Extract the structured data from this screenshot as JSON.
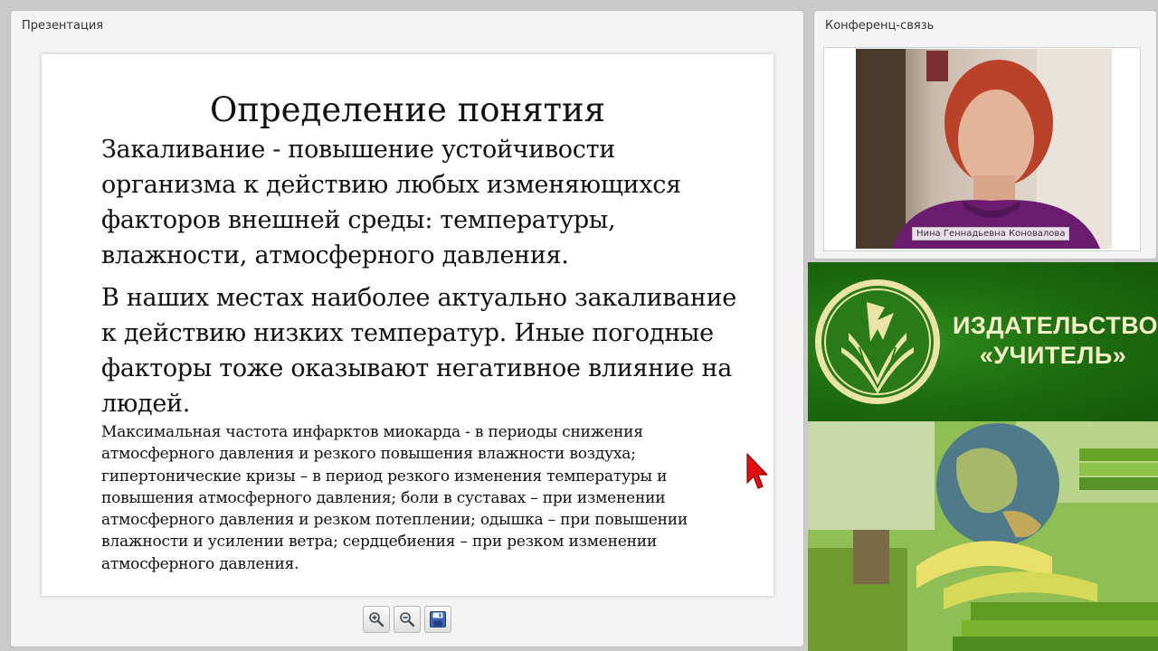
{
  "presentation": {
    "panel_title": "Презентация",
    "slide": {
      "title": "Определение понятия",
      "paragraph_1": "Закаливание - повышение устойчивости организма к действию любых изменяющихся факторов внешней среды: температуры, влажности, атмосферного давления.",
      "paragraph_2": "В наших местах наиболее актуально закаливание к действию низких температур. Иные погодные факторы тоже оказывают негативное влияние на людей.",
      "paragraph_3": "Максимальная частота инфарктов миокарда - в периоды снижения атмосферного давления и резкого повышения влажности воздуха; гипертонические кризы – в период резкого изменения температуры и повышения атмосферного давления; боли в суставах – при изменении атмосферного давления и резком потеплении; одышка – при повышении влажности и усилении ветра; сердцебиения – при резком изменении атмосферного давления."
    },
    "toolbar": {
      "zoom_in_icon": "zoom-in-icon",
      "zoom_out_icon": "zoom-out-icon",
      "save_icon": "floppy-disk-icon"
    }
  },
  "conference": {
    "panel_title": "Конференц-связь",
    "speaker_name": "Нина Геннадьевна Коновалова"
  },
  "banner": {
    "publisher_name": "ИЗДАТЕЛЬСТВО «УЧИТЕЛЬ»"
  },
  "colors": {
    "banner_green": "#1d6a10",
    "banner_text": "#f3f0c8",
    "cursor_red": "#e01010"
  }
}
